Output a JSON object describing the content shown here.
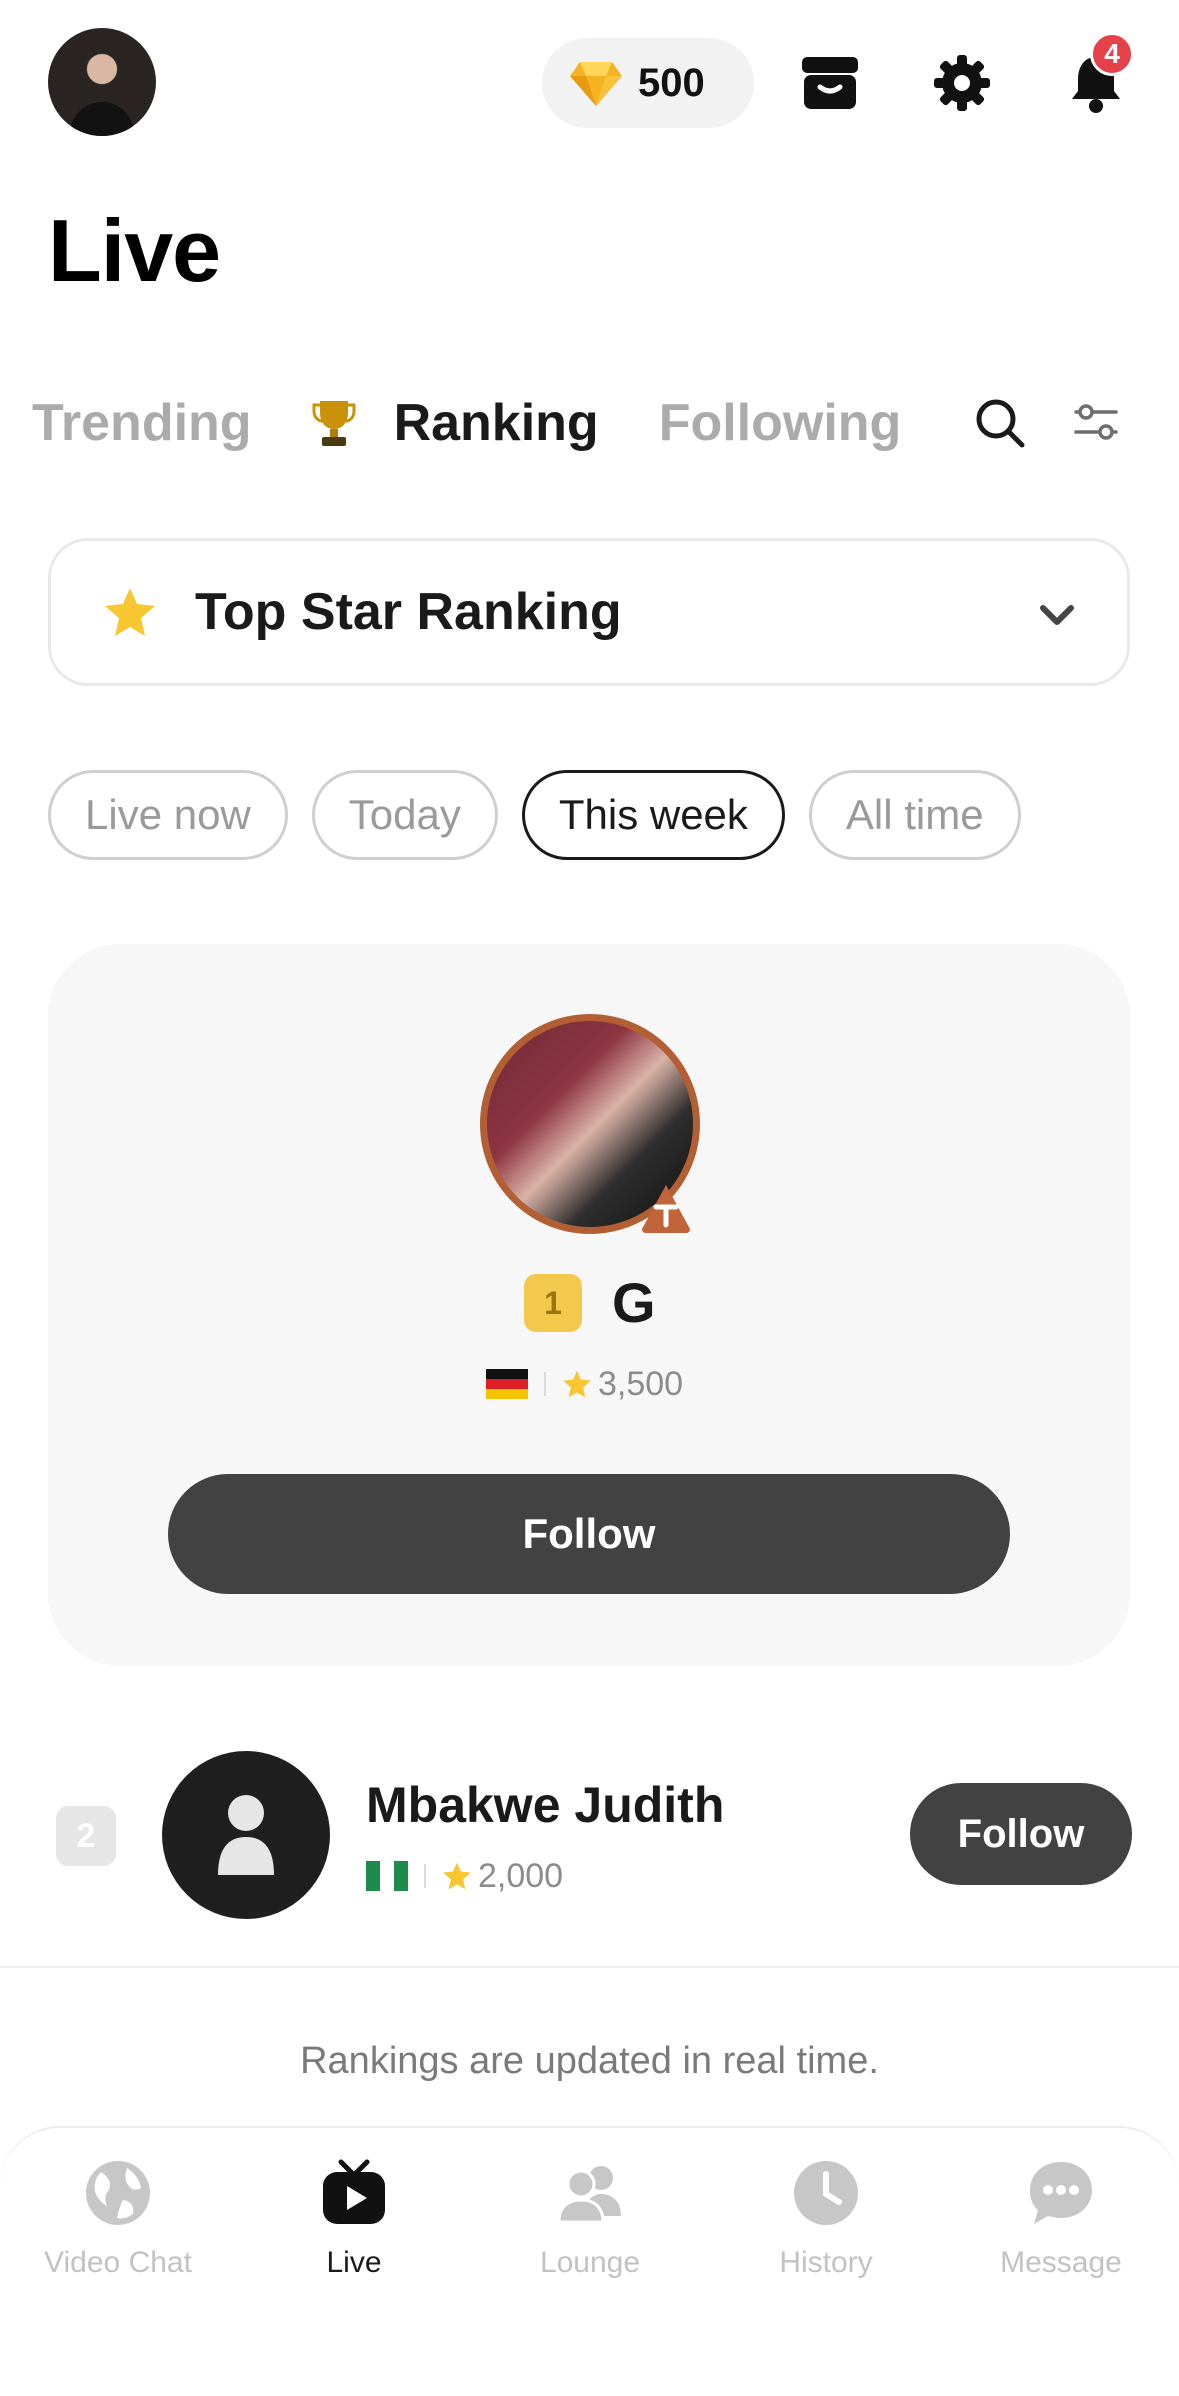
{
  "header": {
    "gem_count": "500",
    "notification_count": "4"
  },
  "page_title": "Live",
  "tabs": [
    {
      "label": "Trending",
      "active": false
    },
    {
      "label": "Ranking",
      "active": true
    },
    {
      "label": "Following",
      "active": false
    }
  ],
  "ranking_select": {
    "label": "Top Star Ranking"
  },
  "periods": [
    {
      "label": "Live now",
      "active": false
    },
    {
      "label": "Today",
      "active": false
    },
    {
      "label": "This week",
      "active": true
    },
    {
      "label": "All time",
      "active": false
    }
  ],
  "top_star": {
    "rank": "1",
    "name": "G",
    "country": "Germany",
    "score": "3,500",
    "follow_label": "Follow"
  },
  "ranking_list": [
    {
      "rank": "2",
      "name": "Mbakwe Judith",
      "country": "Nigeria",
      "score": "2,000",
      "follow_label": "Follow"
    }
  ],
  "footer_note": "Rankings are updated in real time.",
  "bottom_nav": [
    {
      "label": "Video Chat",
      "icon": "globe-icon",
      "active": false
    },
    {
      "label": "Live",
      "icon": "tv-play-icon",
      "active": true
    },
    {
      "label": "Lounge",
      "icon": "people-icon",
      "active": false
    },
    {
      "label": "History",
      "icon": "clock-icon",
      "active": false
    },
    {
      "label": "Message",
      "icon": "chat-bubble-icon",
      "active": false
    }
  ],
  "colors": {
    "accent_dark": "#424242",
    "badge_red": "#e5414b",
    "gold": "#f2c94c",
    "bronze_ring": "#b35f34"
  }
}
